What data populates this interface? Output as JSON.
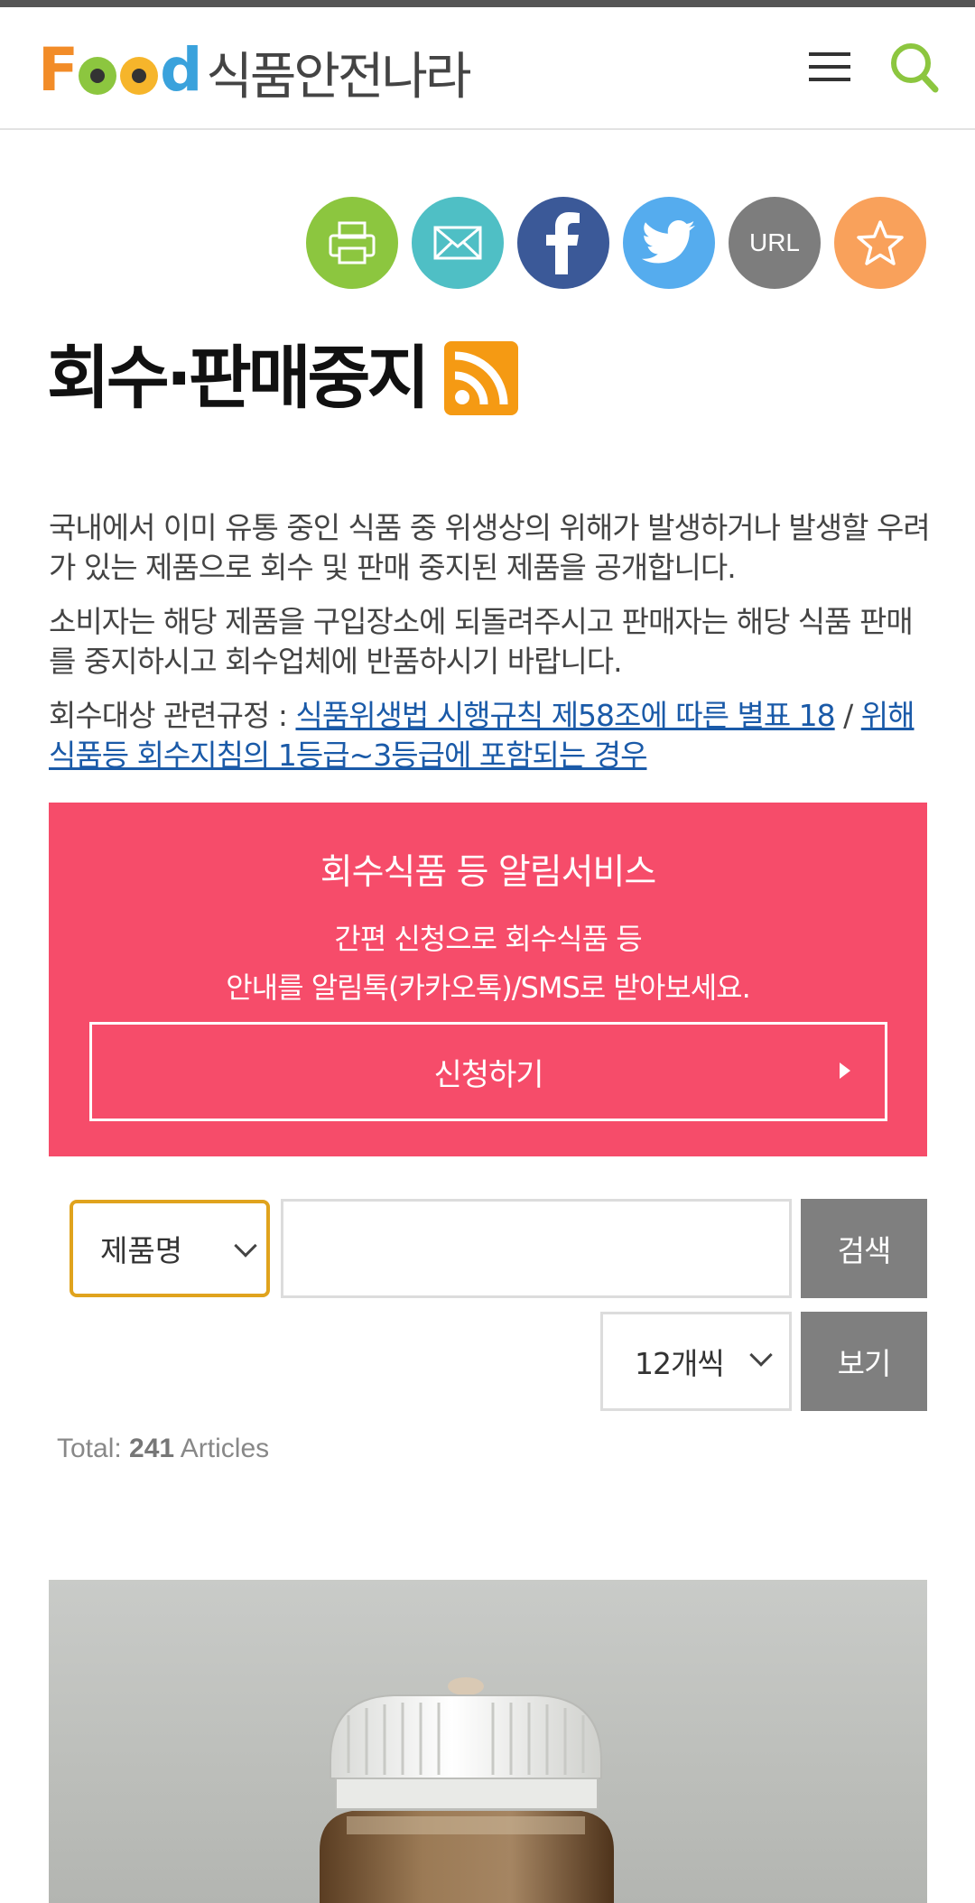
{
  "header": {
    "logo_text_kr": "식품안전나라",
    "colors": {
      "food_f": "#f28c28",
      "food_o1": "#8cc63f",
      "food_o2": "#f6b52b",
      "food_d": "#3aa2dc"
    }
  },
  "share": {
    "icons": [
      "printer-icon",
      "mail-icon",
      "facebook-icon",
      "twitter-icon",
      "url-icon",
      "star-icon"
    ],
    "url_label": "URL"
  },
  "page": {
    "title": "회수·판매중지",
    "desc1": "국내에서 이미 유통 중인 식품 중 위생상의 위해가 발생하거나 발생할 우려가 있는 제품으로 회수 및 판매 중지된 제품을 공개합니다.",
    "desc2": "소비자는 해당 제품을 구입장소에 되돌려주시고 판매자는 해당 식품 판매를 중지하시고 회수업체에 반품하시기 바랍니다.",
    "rule_prefix": "회수대상 관련규정 : ",
    "rule_link1": "식품위생법 시행규칙 제58조에 따른 별표 18",
    "rule_sep": " / ",
    "rule_link2": "위해식품등 회수지침의 1등급~3등급에 포함되는 경우"
  },
  "notice": {
    "title": "회수식품 등 알림서비스",
    "line1": "간편 신청으로 회수식품 등",
    "line2": "안내를 알림톡(카카오톡)/SMS로 받아보세요.",
    "apply_label": "신청하기",
    "bg_color": "#f64c6a"
  },
  "search": {
    "field_selected": "제품명",
    "keyword_value": "",
    "search_label": "검색",
    "per_page_selected": "12개씩",
    "view_label": "보기",
    "focus_color": "#e0a31d"
  },
  "results": {
    "total_prefix": "Total: ",
    "total_count": "241",
    "total_suffix": " Articles"
  }
}
